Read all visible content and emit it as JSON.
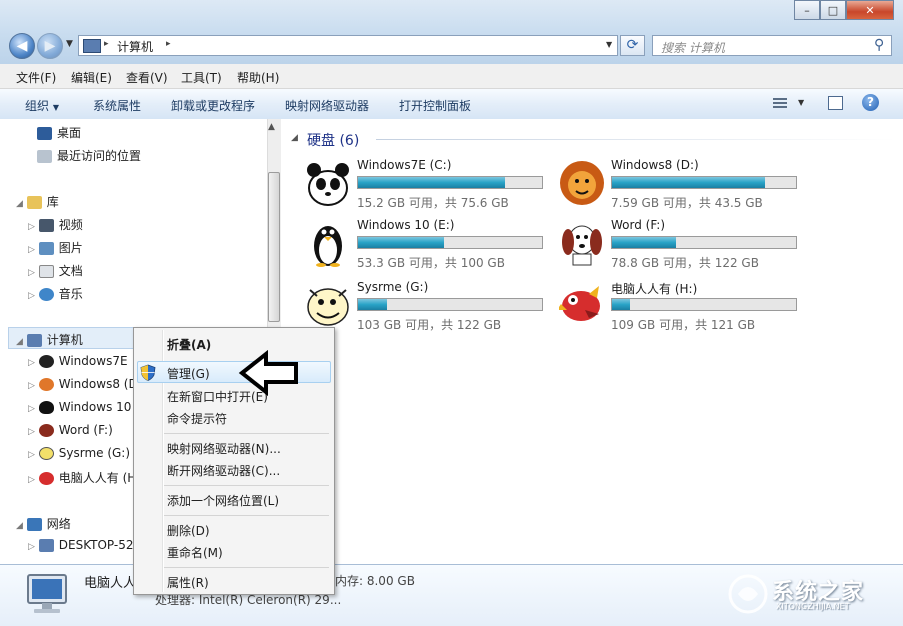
{
  "window": {
    "minimize": "–",
    "maximize": "□",
    "close": "✕"
  },
  "address": {
    "path": [
      "计算机"
    ],
    "sep": "▸"
  },
  "search": {
    "placeholder": "搜索 计算机",
    "icon": "search-icon"
  },
  "menubar": [
    "文件(F)",
    "编辑(E)",
    "查看(V)",
    "工具(T)",
    "帮助(H)"
  ],
  "toolbar": {
    "organize": "组织",
    "items": [
      "系统属性",
      "卸载或更改程序",
      "映射网络驱动器",
      "打开控制面板"
    ]
  },
  "nav": {
    "favorites": [
      "桌面",
      "最近访问的位置"
    ],
    "library": {
      "label": "库",
      "items": [
        "视频",
        "图片",
        "文档",
        "音乐"
      ]
    },
    "computer": {
      "label": "计算机",
      "items": [
        "Windows7E",
        "Windows8 (D",
        "Windows 10",
        "Word (F:)",
        "Sysrme (G:)",
        "电脑人人有 (H"
      ]
    },
    "network": {
      "label": "网络",
      "items": [
        "DESKTOP-52"
      ]
    }
  },
  "content": {
    "group_title": "硬盘 (6)",
    "drives": [
      {
        "name": "Windows7E (C:)",
        "free": "15.2 GB 可用，共 75.6 GB",
        "used_fraction": 0.8,
        "icon": "panda-icon"
      },
      {
        "name": "Windows8 (D:)",
        "free": "7.59 GB 可用，共 43.5 GB",
        "used_fraction": 0.83,
        "icon": "lion-icon"
      },
      {
        "name": "Windows 10 (E:)",
        "free": "53.3 GB 可用，共 100 GB",
        "used_fraction": 0.47,
        "icon": "penguin-icon"
      },
      {
        "name": "Word (F:)",
        "free": "78.8 GB 可用，共 122 GB",
        "used_fraction": 0.35,
        "icon": "dog-icon"
      },
      {
        "name": "Sysrme (G:)",
        "free": "103 GB 可用，共 122 GB",
        "used_fraction": 0.16,
        "icon": "cartoon-icon"
      },
      {
        "name": "电脑人人有 (H:)",
        "free": "109 GB 可用，共 121 GB",
        "used_fraction": 0.1,
        "icon": "bird-icon"
      }
    ]
  },
  "context_menu": {
    "collapse": "折叠(A)",
    "manage": "管理(G)",
    "open_new_window": "在新窗口中打开(E)",
    "cmd": "命令提示符",
    "map_drive": "映射网络驱动器(N)...",
    "disconnect_drive": "断开网络驱动器(C)...",
    "add_location": "添加一个网络位置(L)",
    "delete": "删除(D)",
    "rename": "重命名(M)",
    "properties": "属性(R)"
  },
  "details": {
    "name": "电脑人人",
    "memory": "内存: 8.00 GB",
    "processor": "处理器: Intel(R) Celeron(R) 29..."
  },
  "watermark": {
    "text": "系统之家",
    "sub": "XITONGZHIJIA.NET"
  },
  "colors": {
    "accent": "#1e3c63",
    "drive_fill": "#29a3c7",
    "selection": "#e3eef9"
  }
}
